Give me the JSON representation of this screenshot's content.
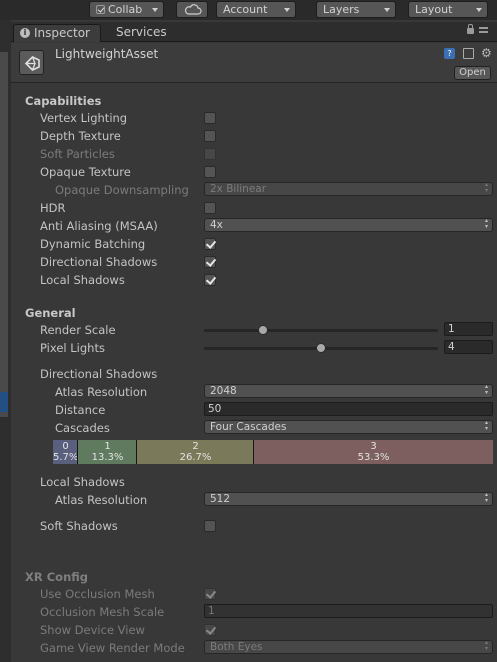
{
  "toolbar": {
    "collab_label": "Collab",
    "account_label": "Account",
    "layers_label": "Layers",
    "layout_label": "Layout",
    "cloud_icon": "cloud-icon"
  },
  "tabs": [
    {
      "label": "Inspector",
      "active": true
    },
    {
      "label": "Services",
      "active": false
    }
  ],
  "asset": {
    "title": "LightweightAsset",
    "open_label": "Open",
    "help_glyph": "?"
  },
  "capabilities": {
    "heading": "Capabilities",
    "vertex_lighting": {
      "label": "Vertex Lighting",
      "checked": false
    },
    "depth_texture": {
      "label": "Depth Texture",
      "checked": false
    },
    "soft_particles": {
      "label": "Soft Particles",
      "checked": false,
      "disabled": true
    },
    "opaque_texture": {
      "label": "Opaque Texture",
      "checked": false
    },
    "opaque_downsampling": {
      "label": "Opaque Downsampling",
      "value": "2x Bilinear",
      "disabled": true
    },
    "hdr": {
      "label": "HDR",
      "checked": false
    },
    "anti_aliasing": {
      "label": "Anti Aliasing (MSAA)",
      "value": "4x"
    },
    "dynamic_batching": {
      "label": "Dynamic Batching",
      "checked": true
    },
    "directional_shadows": {
      "label": "Directional Shadows",
      "checked": true
    },
    "local_shadows": {
      "label": "Local Shadows",
      "checked": true
    }
  },
  "general": {
    "heading": "General",
    "render_scale": {
      "label": "Render Scale",
      "value": "1",
      "fraction": 0.25
    },
    "pixel_lights": {
      "label": "Pixel Lights",
      "value": "4",
      "fraction": 0.5
    },
    "directional_shadows_heading": "Directional Shadows",
    "atlas_resolution": {
      "label": "Atlas Resolution",
      "value": "2048"
    },
    "distance": {
      "label": "Distance",
      "value": "50"
    },
    "cascades": {
      "label": "Cascades",
      "value": "Four Cascades"
    },
    "cascade_split": [
      {
        "index": "0",
        "percent": "5.7%",
        "share": 0.057,
        "color": "#5a5f7d"
      },
      {
        "index": "1",
        "percent": "13.3%",
        "share": 0.133,
        "color": "#5f7a5e"
      },
      {
        "index": "2",
        "percent": "26.7%",
        "share": 0.267,
        "color": "#7a7a5b"
      },
      {
        "index": "3",
        "percent": "53.3%",
        "share": 0.533,
        "color": "#7d5f5f"
      }
    ],
    "local_shadows_heading": "Local Shadows",
    "local_atlas_resolution": {
      "label": "Atlas Resolution",
      "value": "512"
    },
    "soft_shadows": {
      "label": "Soft Shadows",
      "checked": false
    }
  },
  "xr": {
    "heading": "XR Config",
    "use_occlusion_mesh": {
      "label": "Use Occlusion Mesh",
      "checked": true
    },
    "occlusion_mesh_scale": {
      "label": "Occlusion Mesh Scale",
      "value": "1"
    },
    "show_device_view": {
      "label": "Show Device View",
      "checked": true
    },
    "game_view_render_mode": {
      "label": "Game View Render Mode",
      "value": "Both Eyes"
    }
  }
}
